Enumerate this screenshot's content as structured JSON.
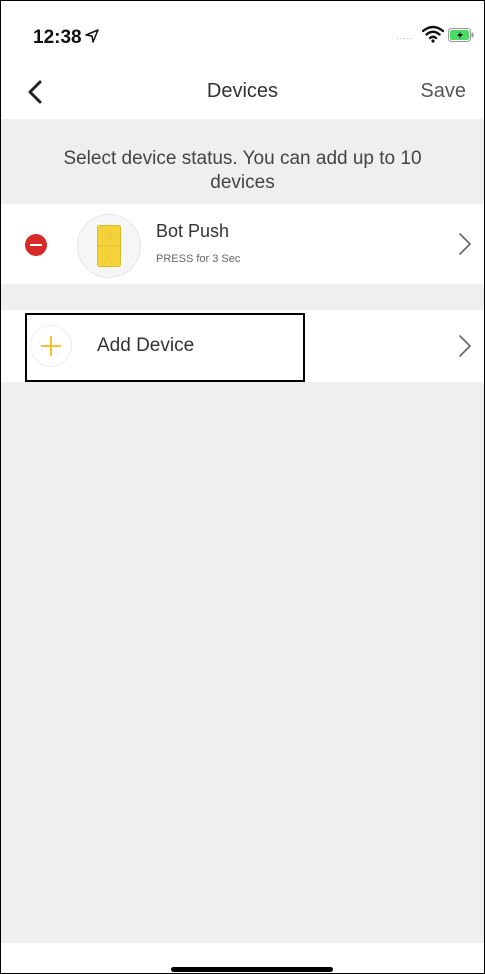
{
  "status_bar": {
    "time": "12:38",
    "signal_dots": "....."
  },
  "nav": {
    "title": "Devices",
    "save_label": "Save"
  },
  "hint": "Select device status. You can add up to 10 devices",
  "devices": [
    {
      "name": "Bot Push",
      "subtitle": "PRESS for 3 Sec"
    }
  ],
  "add_device": {
    "label": "Add Device"
  },
  "icons": {
    "back": "chevron-left-icon",
    "remove": "minus-circle-icon",
    "bot": "switchbot-icon",
    "add": "plus-icon",
    "chevron": "chevron-right-icon",
    "wifi": "wifi-icon",
    "battery": "battery-icon",
    "location": "location-arrow-icon"
  },
  "colors": {
    "remove_red": "#d62b28",
    "bot_yellow": "#f4d23a",
    "plus_yellow": "#f2c230",
    "background": "#efefef"
  }
}
